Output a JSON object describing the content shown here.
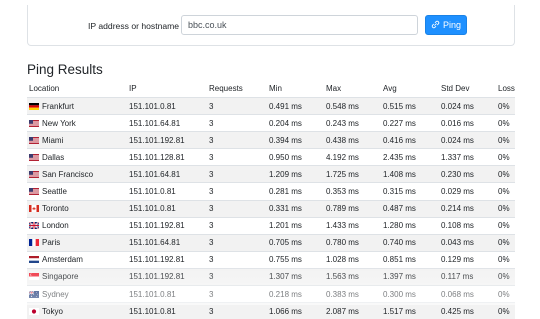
{
  "form": {
    "label": "IP address or hostname",
    "input_value": "bbc.co.uk",
    "button_label": "Ping"
  },
  "results": {
    "title": "Ping Results",
    "columns": [
      "Location",
      "IP",
      "Requests",
      "Min",
      "Max",
      "Avg",
      "Std Dev",
      "Loss"
    ],
    "rows": [
      {
        "location": "Frankfurt",
        "flag": "de",
        "ip": "151.101.0.81",
        "requests": "3",
        "min": "0.491 ms",
        "max": "0.548 ms",
        "avg": "0.515 ms",
        "std": "0.024 ms",
        "loss": "0%"
      },
      {
        "location": "New York",
        "flag": "us",
        "ip": "151.101.64.81",
        "requests": "3",
        "min": "0.204 ms",
        "max": "0.243 ms",
        "avg": "0.227 ms",
        "std": "0.016 ms",
        "loss": "0%"
      },
      {
        "location": "Miami",
        "flag": "us",
        "ip": "151.101.192.81",
        "requests": "3",
        "min": "0.394 ms",
        "max": "0.438 ms",
        "avg": "0.416 ms",
        "std": "0.024 ms",
        "loss": "0%"
      },
      {
        "location": "Dallas",
        "flag": "us",
        "ip": "151.101.128.81",
        "requests": "3",
        "min": "0.950 ms",
        "max": "4.192 ms",
        "avg": "2.435 ms",
        "std": "1.337 ms",
        "loss": "0%"
      },
      {
        "location": "San Francisco",
        "flag": "us",
        "ip": "151.101.64.81",
        "requests": "3",
        "min": "1.209 ms",
        "max": "1.725 ms",
        "avg": "1.408 ms",
        "std": "0.230 ms",
        "loss": "0%"
      },
      {
        "location": "Seattle",
        "flag": "us",
        "ip": "151.101.0.81",
        "requests": "3",
        "min": "0.281 ms",
        "max": "0.353 ms",
        "avg": "0.315 ms",
        "std": "0.029 ms",
        "loss": "0%"
      },
      {
        "location": "Toronto",
        "flag": "ca",
        "ip": "151.101.0.81",
        "requests": "3",
        "min": "0.331 ms",
        "max": "0.789 ms",
        "avg": "0.487 ms",
        "std": "0.214 ms",
        "loss": "0%"
      },
      {
        "location": "London",
        "flag": "gb",
        "ip": "151.101.192.81",
        "requests": "3",
        "min": "1.201 ms",
        "max": "1.433 ms",
        "avg": "1.280 ms",
        "std": "0.108 ms",
        "loss": "0%"
      },
      {
        "location": "Paris",
        "flag": "fr",
        "ip": "151.101.64.81",
        "requests": "3",
        "min": "0.705 ms",
        "max": "0.780 ms",
        "avg": "0.740 ms",
        "std": "0.043 ms",
        "loss": "0%"
      },
      {
        "location": "Amsterdam",
        "flag": "nl",
        "ip": "151.101.192.81",
        "requests": "3",
        "min": "0.755 ms",
        "max": "1.028 ms",
        "avg": "0.851 ms",
        "std": "0.129 ms",
        "loss": "0%"
      },
      {
        "location": "Singapore",
        "flag": "sg",
        "ip": "151.101.192.81",
        "requests": "3",
        "min": "1.307 ms",
        "max": "1.563 ms",
        "avg": "1.397 ms",
        "std": "0.117 ms",
        "loss": "0%"
      },
      {
        "location": "Sydney",
        "flag": "au",
        "ip": "151.101.0.81",
        "requests": "3",
        "min": "0.218 ms",
        "max": "0.383 ms",
        "avg": "0.300 ms",
        "std": "0.068 ms",
        "loss": "0%"
      },
      {
        "location": "Tokyo",
        "flag": "jp",
        "ip": "151.101.0.81",
        "requests": "3",
        "min": "1.066 ms",
        "max": "2.087 ms",
        "avg": "1.517 ms",
        "std": "0.425 ms",
        "loss": "0%"
      }
    ]
  },
  "colors": {
    "accent": "#1e90ff",
    "stripe": "#f2f2f2",
    "border": "#dee2e6"
  },
  "icons": {
    "ping_button": "ping-icon"
  }
}
